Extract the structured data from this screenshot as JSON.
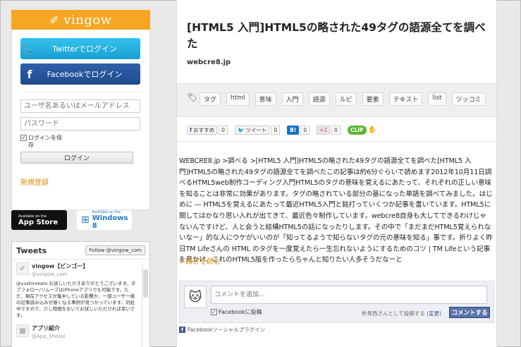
{
  "brand": {
    "logo_text": "vingow"
  },
  "login": {
    "twitter_label": "Twitterでログイン",
    "facebook_label": "Facebookでログイン",
    "username_placeholder": "ユーザ名あるいはメールアドレス",
    "password_placeholder": "パスワード",
    "remember_label_1": "ログインを保",
    "remember_label_2": "存",
    "login_button": "ログイン",
    "signup_link": "新規登録"
  },
  "badges": {
    "appstore_small": "Available on the",
    "appstore_big": "App Store",
    "windows_small": "Available on the",
    "windows_big": "Windows 8"
  },
  "tweets": {
    "title": "Tweets",
    "follow_button": "Follow @vingow_com",
    "items": [
      {
        "name": "vingow【ビンゴー】",
        "handle": "@vingow_com",
        "text": "@yushirokato お試しいただきありがとうございます。タブフォロー/リムーブはiPhoneアプリでも可能です。ただ、現在アクセスが集中している影響か、一部ユーザー様の記事読み込みが遅くなる事例が見つかっています。対処中ですので、少し時間をおいてお試しいただければ幸いです。"
      },
      {
        "name": "アプリ紹介",
        "handle": "@App_Shokai",
        "text": ""
      }
    ]
  },
  "article": {
    "title": "[HTML5 入門]HTML5の略された49タグの語源全てを調べた",
    "source": "webcre8.jp",
    "tags": [
      "タグ",
      "html",
      "意味",
      "入門",
      "語源",
      "ルビ",
      "要素",
      "テキスト",
      "list",
      "ツッコミ"
    ],
    "body": "WEBCRE8.jp >調べる >[HTML5 入門]HTML5の略された49タグの語源全てを調べた[HTML5 入門]HTML5の略された49タグの語源全てを調べたこの記事は約6分ぐらいで読めます2012年10月11日調べるHTML5web制作コーディング入門HTML5のタグの意味を覚えるにあたって、それぞれの正しい意味を知ることは非常に効果があります。タグの略されている部分の基になった単語を調べてみました。はじめに — HTML5を覚えるにあたって最近HTML5入門と銘打っていくつか記事を書いています。HTML5に関してはかなり思い入れが出てきて、最近色々制作しています。webcre8自身も大してできるわけじゃないんですけど、人と会うと結構HTML5の話になったりします。その中で「まだまだHTML5覚えられないなー」的な人にウケがいいのが「知ってるようで知らないタグの元の意味を知る」事です。折りよく昨日TM Lifeさんの HTML のタグを一度覚えたら一生忘れないようにするためのコツ | TM Lifeという記事を見かけ、これのHTML5版を作ったらちゃんと知りたい人多そうだなーと",
    "read_more": "続きを読む"
  },
  "share": {
    "recommend_label": "おすすめ",
    "recommend_count": "0",
    "tweet_label": "ツイート",
    "tweet_count": "0",
    "hatena_label": "B!",
    "hatena_count": "0",
    "gplus_label": "+1",
    "gplus_count": "0",
    "clip_label": "CLIP"
  },
  "comments": {
    "placeholder": "コメントを追加...",
    "post_to_facebook": "Facebookに投稿",
    "posting_as": "朴寿西さんとして投稿する",
    "change_label": "(変更)",
    "submit_button": "コメントする",
    "plugin_label": "Facebookソーシャルプラグイン"
  }
}
